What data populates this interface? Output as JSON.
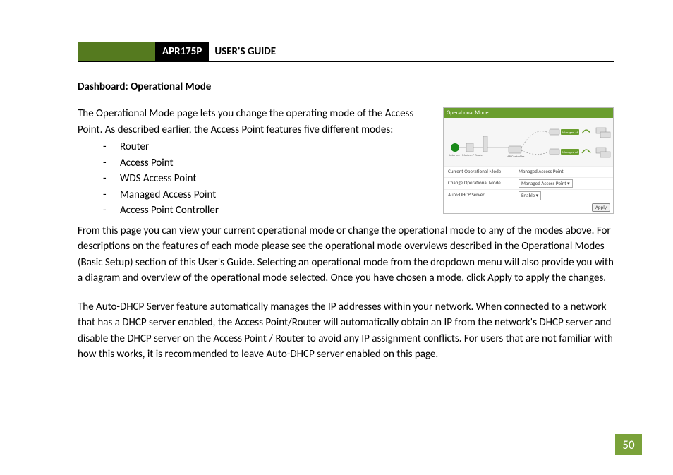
{
  "header": {
    "model": "APR175P",
    "title": "USER'S GUIDE"
  },
  "section_title": "Dashboard: Operational Mode",
  "intro": "The Operational Mode page lets you change the operating mode of the Access Point. As described earlier, the Access Point features five different modes:",
  "modes": [
    "Router",
    "Access Point",
    "WDS Access Point",
    "Managed Access Point",
    "Access Point Controller"
  ],
  "para2": "From this page you can view your current operational mode or change the operational mode to any of the modes above. For descriptions on the features of each mode please see the operational mode overviews described in the Operational Modes (Basic Setup) section of this User's Guide. Selecting an operational mode from the dropdown menu will also provide you with a diagram and overview of the operational mode selected. Once you have chosen a mode, click Apply to apply the changes.",
  "para3": "The Auto-DHCP Server feature automatically manages the IP addresses within your network. When connected to a network that has a DHCP server enabled, the Access Point/Router will automatically obtain an IP from the network's DHCP server and disable the DHCP server on the Access Point / Router to avoid any IP assignment conflicts. For users that are not familiar with how this works, it is recommended to leave Auto-DHCP server enabled on this page.",
  "figure": {
    "bar_title": "Operational Mode",
    "diagram_labels": {
      "internet": "Internet",
      "modem": "Modem / Router",
      "controller": "AP Controller",
      "ap1": "Managed AP",
      "ap2": "Managed AP"
    },
    "rows": {
      "current_k": "Current Operational Mode",
      "current_v": "Managed Access Point",
      "change_k": "Change Operational Mode",
      "change_v": "Managed Access Point",
      "dhcp_k": "Auto-DHCP Server",
      "dhcp_v": "Enable"
    },
    "apply": "Apply"
  },
  "page_number": "50"
}
